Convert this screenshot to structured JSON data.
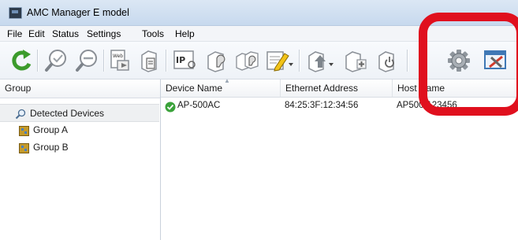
{
  "window": {
    "title": "AMC Manager E model"
  },
  "menu": [
    "File",
    "Edit",
    "Status",
    "Settings",
    "Tools",
    "Help"
  ],
  "toolbar": {
    "buttons": [
      "refresh-icon",
      "search-device-icon",
      "search-clear-icon",
      "web-config-icon",
      "device-info-icon",
      "ip-settings-icon",
      "device-settings-icon",
      "group-settings-icon",
      "edit-icon",
      "firmware-update-icon",
      "add-device-icon",
      "restart-device-icon",
      "settings-gear-icon",
      "tools-icon"
    ]
  },
  "groups": {
    "header": "Group",
    "items": [
      {
        "label": "Detected Devices",
        "icon": "search-icon",
        "selected": true
      },
      {
        "label": "Group A",
        "icon": "group-icon"
      },
      {
        "label": "Group B",
        "icon": "group-icon"
      }
    ]
  },
  "devices": {
    "columns": [
      "Device Name",
      "Ethernet Address",
      "Host Name"
    ],
    "rows": [
      {
        "device_name": "AP-500AC",
        "ethernet_address": "84:25:3F:12:34:56",
        "host_name": "AP500-123456",
        "status": "ok"
      }
    ]
  },
  "colors": {
    "highlight": "#e0101e",
    "status_ok": "#3aa23a",
    "refresh": "#3c9b2c"
  }
}
